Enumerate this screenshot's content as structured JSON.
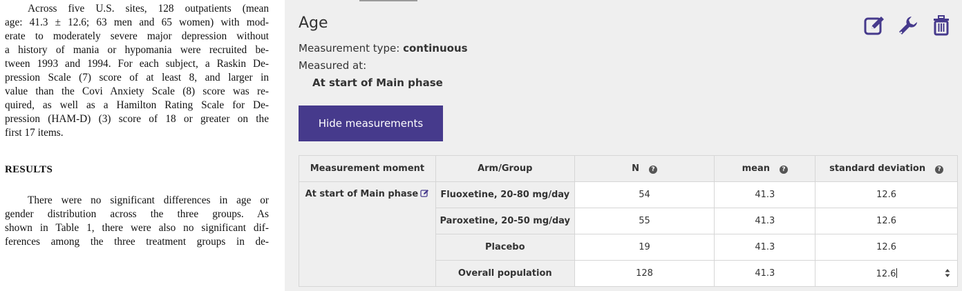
{
  "paper": {
    "para1_lines": [
      "Across five U.S. sites, 128 outpatients (mean",
      "age: 41.3 ± 12.6; 63 men and 65 women) with mod-",
      "erate to moderately severe major depression without",
      "a history of mania or hypomania were recruited be-",
      "tween 1993 and 1994. For each subject, a Raskin De-",
      "pression Scale (7) score of at least 8, and larger in",
      "value than the Covi Anxiety Scale (8) score was re-",
      "quired, as well as a Hamilton Rating Scale for De-",
      "pression (HAM-D) (3) score of 18 or greater on the",
      "first 17 items."
    ],
    "results_heading": "RESULTS",
    "para2_lines": [
      "There were no significant differences in age or",
      "gender distribution across the three groups. As",
      "shown in Table 1, there were also no significant dif-",
      "ferences among the three treatment groups in de-"
    ]
  },
  "variable": {
    "title": "Age",
    "measurement_type_label": "Measurement type:",
    "measurement_type_value": "continuous",
    "measured_at_label": "Measured at:",
    "measured_at_value": "At start of Main phase",
    "hide_button": "Hide measurements"
  },
  "actions": {
    "edit_icon": "edit-icon",
    "settings_icon": "wrench-icon",
    "delete_icon": "trash-icon",
    "accent_color": "#463a8c"
  },
  "table": {
    "headers": {
      "moment": "Measurement moment",
      "arm": "Arm/Group",
      "n": "N",
      "mean": "mean",
      "sd": "standard deviation"
    },
    "moment": "At start of Main phase",
    "rows": [
      {
        "arm": "Fluoxetine, 20-80 mg/day",
        "n": "54",
        "mean": "41.3",
        "sd": "12.6"
      },
      {
        "arm": "Paroxetine, 20-50 mg/day",
        "n": "55",
        "mean": "41.3",
        "sd": "12.6"
      },
      {
        "arm": "Placebo",
        "n": "19",
        "mean": "41.3",
        "sd": "12.6"
      },
      {
        "arm": "Overall population",
        "n": "128",
        "mean": "41.3",
        "sd": "12.6"
      }
    ]
  }
}
